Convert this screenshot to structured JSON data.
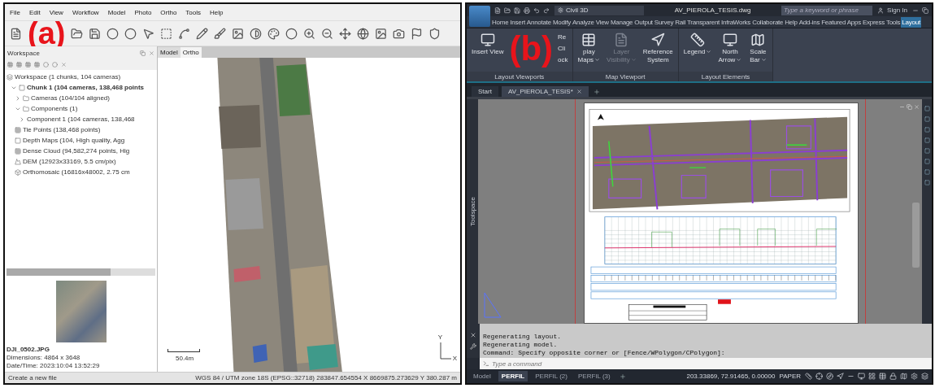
{
  "photogrammetry_app": {
    "figure_label": "(a)",
    "menu": [
      "File",
      "Edit",
      "View",
      "Workflow",
      "Model",
      "Photo",
      "Ortho",
      "Tools",
      "Help"
    ],
    "workspace": {
      "title": "Workspace",
      "tree": [
        {
          "label": "Workspace (1 chunks, 104 cameras)",
          "kind": "workspace",
          "children": [
            {
              "label": "Chunk 1 (104 cameras, 138,468 points",
              "kind": "chunk",
              "expanded": true,
              "children": [
                {
                  "label": "Cameras (104/104 aligned)",
                  "kind": "folder",
                  "expanded": false
                },
                {
                  "label": "Components (1)",
                  "kind": "folder",
                  "expanded": true,
                  "children": [
                    {
                      "label": "Component 1 (104 cameras, 138,468",
                      "expanded": false
                    }
                  ]
                },
                {
                  "label": "Tie Points (138,468 points)",
                  "kind": "points"
                },
                {
                  "label": "Depth Maps (104, High quality, Agg",
                  "kind": "depth"
                },
                {
                  "label": "Dense Cloud (94,582,274 points, Hig",
                  "kind": "cloud"
                },
                {
                  "label": "DEM (12923x33169, 5.5 cm/pix)",
                  "kind": "dem"
                },
                {
                  "label": "Orthomosaic (16816x48002, 2.75 cm",
                  "kind": "ortho"
                }
              ]
            }
          ]
        }
      ]
    },
    "photo": {
      "filename": "DJI_0502.JPG",
      "dimensions": "Dimensions: 4864 x 3648",
      "datetime": "Date/Time: 2023:10:04 13:52:29"
    },
    "view_tabs": [
      {
        "label": "Model",
        "selected": false
      },
      {
        "label": "Ortho",
        "selected": true
      }
    ],
    "scale_bar": "50.4m",
    "axes": {
      "y": "Y",
      "x": "X"
    },
    "status_bar": {
      "message": "Create a new file",
      "coordinates": "WGS 84 / UTM zone 18S (EPSG::32718)  283847.654554 X  8669875.273629 Y  380.287 m"
    }
  },
  "cad_app": {
    "figure_label": "(b)",
    "workspace_name": "Civil 3D",
    "document_title": "AV_PIEROLA_TESIS.dwg",
    "search": {
      "placeholder": "Type a keyword or phrase"
    },
    "sign_in": "Sign In",
    "ribbon_tabs": [
      {
        "label": "Home",
        "selected": false
      },
      {
        "label": "Insert",
        "selected": false
      },
      {
        "label": "Annotate",
        "selected": false
      },
      {
        "label": "Modify",
        "selected": false
      },
      {
        "label": "Analyze",
        "selected": false
      },
      {
        "label": "View",
        "selected": false
      },
      {
        "label": "Manage",
        "selected": false
      },
      {
        "label": "Output",
        "selected": false
      },
      {
        "label": "Survey",
        "selected": false
      },
      {
        "label": "Rail",
        "selected": false
      },
      {
        "label": "Transparent",
        "selected": false
      },
      {
        "label": "InfraWorks",
        "selected": false
      },
      {
        "label": "Collaborate",
        "selected": false
      },
      {
        "label": "Help",
        "selected": false
      },
      {
        "label": "Add-ins",
        "selected": false
      },
      {
        "label": "Featured Apps",
        "selected": false
      },
      {
        "label": "Express Tools",
        "selected": false
      },
      {
        "label": "Layout",
        "selected": true
      }
    ],
    "ribbon_groups": [
      {
        "title": "Layout Viewports",
        "buttons": [
          {
            "kind": "large",
            "lines": [
              "Insert View"
            ],
            "disabled": false,
            "dropdown": false
          },
          {
            "kind": "stack",
            "lines": [
              "Re",
              "Cli",
              "ock"
            ]
          }
        ]
      },
      {
        "title": "Map Viewport",
        "buttons": [
          {
            "kind": "large",
            "lines": [
              "play",
              "Maps"
            ],
            "disabled": false,
            "dropdown": true
          },
          {
            "kind": "large",
            "lines": [
              "Layer",
              "Visibility"
            ],
            "disabled": true,
            "dropdown": true
          },
          {
            "kind": "large",
            "lines": [
              "Reference",
              "System"
            ],
            "disabled": false,
            "dropdown": false
          }
        ]
      },
      {
        "title": "Layout Elements",
        "buttons": [
          {
            "kind": "large",
            "lines": [
              "Legend"
            ],
            "disabled": false,
            "dropdown": true
          },
          {
            "kind": "large",
            "lines": [
              "North",
              "Arrow"
            ],
            "disabled": false,
            "dropdown": true
          },
          {
            "kind": "large",
            "lines": [
              "Scale",
              "Bar"
            ],
            "disabled": false,
            "dropdown": true
          }
        ]
      }
    ],
    "doc_tabs": [
      {
        "label": "Start",
        "selected": false
      },
      {
        "label": "AV_PIEROLA_TESIS*",
        "selected": true
      }
    ],
    "side_palette": "Toolspace",
    "command_history": [
      "Regenerating layout.",
      "Regenerating model.",
      "Command: Specify opposite corner or [Fence/WPolygon/CPolygon]:"
    ],
    "command_input": {
      "placeholder": "Type a command"
    },
    "layout_tabs": [
      {
        "label": "Model",
        "selected": false
      },
      {
        "label": "PERFIL",
        "selected": true
      },
      {
        "label": "PERFIL (2)",
        "selected": false
      },
      {
        "label": "PERFIL (3)",
        "selected": false
      }
    ],
    "coordinates": "203.33869, 72.91465, 0.00000",
    "space": "PAPER"
  }
}
